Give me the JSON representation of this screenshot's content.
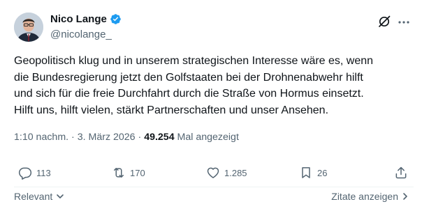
{
  "author": {
    "name": "Nico Lange",
    "handle": "@nicolange_"
  },
  "tweet": {
    "lines": [
      "Geopolitisch klug und in unserem strategischen Interesse wäre es, wenn",
      "die Bundesregierung jetzt den Golfstaaten bei der Drohnenabwehr hilft",
      "und sich für die freie Durchfahrt durch die Straße von Hormus einsetzt.",
      "Hilft uns, hilft vielen, stärkt Partnerschaften und unser Ansehen."
    ]
  },
  "meta": {
    "time": "1:10 nachm.",
    "sep1": "·",
    "date": "3. März 2026",
    "sep2": "·",
    "views": "49.254",
    "views_label": "Mal angezeigt"
  },
  "actions": {
    "replies": "113",
    "reposts": "170",
    "likes": "1.285",
    "bookmarks": "26"
  },
  "footer": {
    "sort_label": "Relevant",
    "quotes_label": "Zitate anzeigen"
  },
  "colors": {
    "verified": "#1d9bf0",
    "text": "#0f1419",
    "secondary": "#536471"
  },
  "icons": [
    "verified-badge-icon",
    "grok-icon",
    "more-icon",
    "reply-icon",
    "repost-icon",
    "like-icon",
    "bookmark-icon",
    "share-icon",
    "chevron-down-icon",
    "chevron-right-icon"
  ]
}
